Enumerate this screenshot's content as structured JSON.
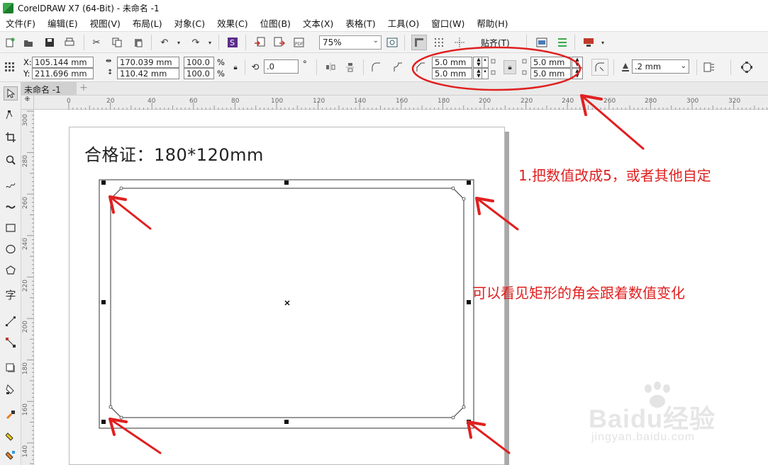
{
  "window": {
    "title": "CorelDRAW X7 (64-Bit) - 未命名 -1"
  },
  "menu": {
    "items": [
      "文件(F)",
      "编辑(E)",
      "视图(V)",
      "布局(L)",
      "对象(C)",
      "效果(C)",
      "位图(B)",
      "文本(X)",
      "表格(T)",
      "工具(O)",
      "窗口(W)",
      "帮助(H)"
    ]
  },
  "toolbar": {
    "zoom_value": "75%",
    "snap_label": "贴齐(T)"
  },
  "property_bar": {
    "x": "105.144 mm",
    "y": "211.696 mm",
    "width": "170.039 mm",
    "height": "110.42 mm",
    "scale_w": "100.0",
    "scale_h": "100.0",
    "percent": "%",
    "rotation": ".0",
    "degree": "°",
    "x_label": "X:",
    "y_label": "Y:",
    "corner_tl": "5.0 mm",
    "corner_bl": "5.0 mm",
    "corner_tr": "5.0 mm",
    "corner_br": "5.0 mm",
    "outline_width": ".2 mm"
  },
  "document_tabs": {
    "active": "未命名 -1"
  },
  "rulers": {
    "horizontal": [
      "0",
      "20",
      "40",
      "60",
      "80",
      "100",
      "120",
      "140",
      "160",
      "180",
      "200",
      "220",
      "240",
      "260",
      "280",
      "300",
      "320"
    ],
    "vertical": [
      "300",
      "280",
      "260",
      "240",
      "220",
      "200",
      "180",
      "160",
      "140"
    ]
  },
  "canvas": {
    "heading": "合格证：180*120mm"
  },
  "annotations": {
    "note1": "1.把数值改成5，或者其他自定",
    "note2": "可以看见矩形的角会跟着数值变化"
  },
  "watermark": {
    "brand": "Baidu经验",
    "url": "jingyan.baidu.com"
  },
  "colors": {
    "annotation_red": "#e02020",
    "toolbar_bg": "#f3f3f3"
  }
}
